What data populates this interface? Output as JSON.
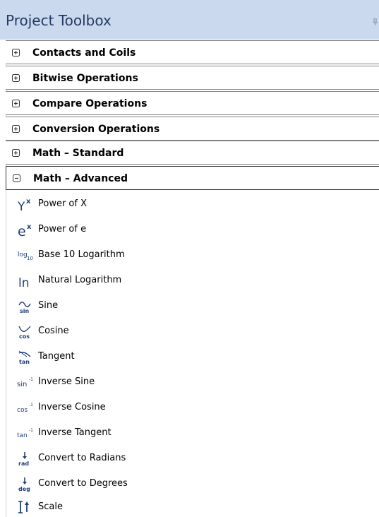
{
  "panel": {
    "title": "Project Toolbox"
  },
  "categories": [
    {
      "label": "Contacts and Coils",
      "state": "collapsed",
      "icon": "plus-box-icon"
    },
    {
      "label": "Bitwise Operations",
      "state": "collapsed",
      "icon": "plus-box-icon"
    },
    {
      "label": "Compare Operations",
      "state": "collapsed",
      "icon": "plus-box-icon"
    },
    {
      "label": "Conversion Operations",
      "state": "collapsed",
      "icon": "plus-box-icon"
    },
    {
      "label": "Math – Standard",
      "state": "collapsed",
      "icon": "plus-box-icon"
    },
    {
      "label": "Math – Advanced",
      "state": "expanded",
      "icon": "minus-box-icon"
    }
  ],
  "items": [
    {
      "label": "Power of X",
      "icon": "power-of-x-icon",
      "glyph": "Y",
      "sup": "x"
    },
    {
      "label": "Power of e",
      "icon": "power-of-e-icon",
      "glyph": "e",
      "sup": "x"
    },
    {
      "label": "Base 10 Logarithm",
      "icon": "log10-icon",
      "glyph": "log",
      "sub": "10"
    },
    {
      "label": "Natural Logarithm",
      "icon": "natural-log-icon",
      "glyph": "ln"
    },
    {
      "label": "Sine",
      "icon": "sine-icon",
      "glyph": "sin"
    },
    {
      "label": "Cosine",
      "icon": "cosine-icon",
      "glyph": "cos"
    },
    {
      "label": "Tangent",
      "icon": "tangent-icon",
      "glyph": "tan"
    },
    {
      "label": "Inverse Sine",
      "icon": "inverse-sine-icon",
      "glyph": "sin",
      "sup": "-1"
    },
    {
      "label": "Inverse Cosine",
      "icon": "inverse-cosine-icon",
      "glyph": "cos",
      "sup": "-1"
    },
    {
      "label": "Inverse Tangent",
      "icon": "inverse-tangent-icon",
      "glyph": "tan",
      "sup": "-1"
    },
    {
      "label": "Convert to Radians",
      "icon": "to-radians-icon",
      "glyph": "rad"
    },
    {
      "label": "Convert to Degrees",
      "icon": "to-degrees-icon",
      "glyph": "deg"
    },
    {
      "label": "Scale",
      "icon": "scale-icon"
    }
  ],
  "colors": {
    "title_bar": "#cbd9ee",
    "title_text": "#233a63",
    "icon_blue": "#1f3f7a"
  }
}
